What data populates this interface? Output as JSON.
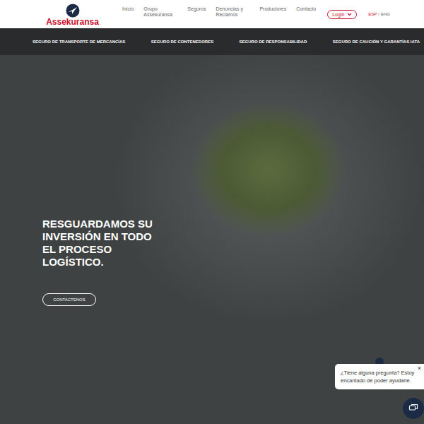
{
  "header": {
    "logo": "Assekuransa",
    "nav": [
      {
        "label": "Inicio"
      },
      {
        "label": "Grupo Assekuransa"
      },
      {
        "label": "Seguros"
      },
      {
        "label": "Denuncias y Reclamos"
      },
      {
        "label": "Productores"
      },
      {
        "label": "Contacto"
      }
    ],
    "login": "Login",
    "languages": [
      {
        "label": "ESP",
        "selected": true
      },
      {
        "label": "ENG",
        "selected": false
      }
    ],
    "language_separator": "/"
  },
  "subnav": [
    "SEGURO DE TRANSPORTE DE MERCANCÍAS",
    "SEGURO DE CONTENEDORES",
    "SEGURO DE RESPONSABILIDAD",
    "SEGURO DE CAUCIÓN Y GARANTÍAS IATA"
  ],
  "hero": {
    "title": "RESGUARDAMOS SU INVERSIÓN EN TODO EL PROCESO LOGÍSTICO.",
    "button": "CONTACTENOS"
  },
  "chat": {
    "message": "¿Tiene alguna pregunta? Estoy encantado de poder ayudarle.",
    "close": "×"
  }
}
